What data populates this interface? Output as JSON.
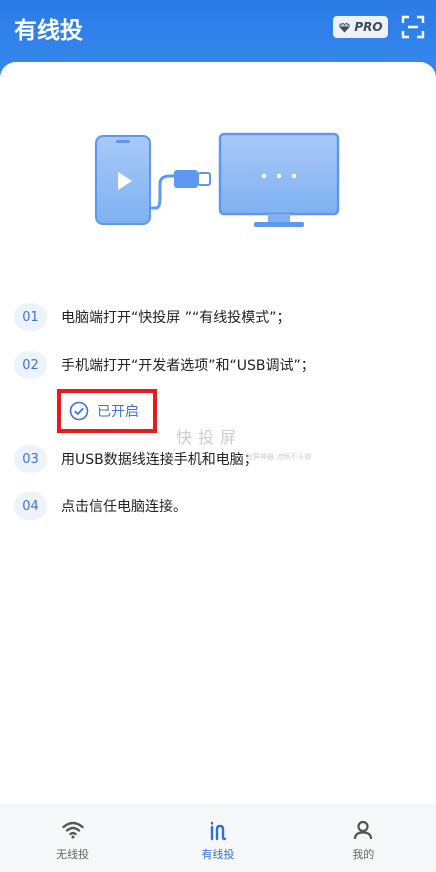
{
  "header": {
    "title": "有线投",
    "pro_label": "PRO"
  },
  "steps": [
    {
      "num": "01",
      "text": "电脑端打开“快投屏 ”“有线投模式”；"
    },
    {
      "num": "02",
      "text": "手机端打开“开发者选项”和“USB调试”；"
    },
    {
      "num": "03",
      "text": "用USB数据线连接手机和电脑；"
    },
    {
      "num": "04",
      "text": "点击信任电脑连接。"
    }
  ],
  "status": {
    "label": "已开启"
  },
  "watermark": {
    "text": "快投屏",
    "sub": "投屏神器,流畅不卡顿"
  },
  "nav": [
    {
      "label": "无线投",
      "icon": "wifi-icon",
      "active": false
    },
    {
      "label": "有线投",
      "icon": "usb-icon",
      "active": true
    },
    {
      "label": "我的",
      "icon": "user-icon",
      "active": false
    }
  ],
  "colors": {
    "accent": "#3e73d6",
    "header": "#2a7be6",
    "highlight": "#e51c1c"
  }
}
